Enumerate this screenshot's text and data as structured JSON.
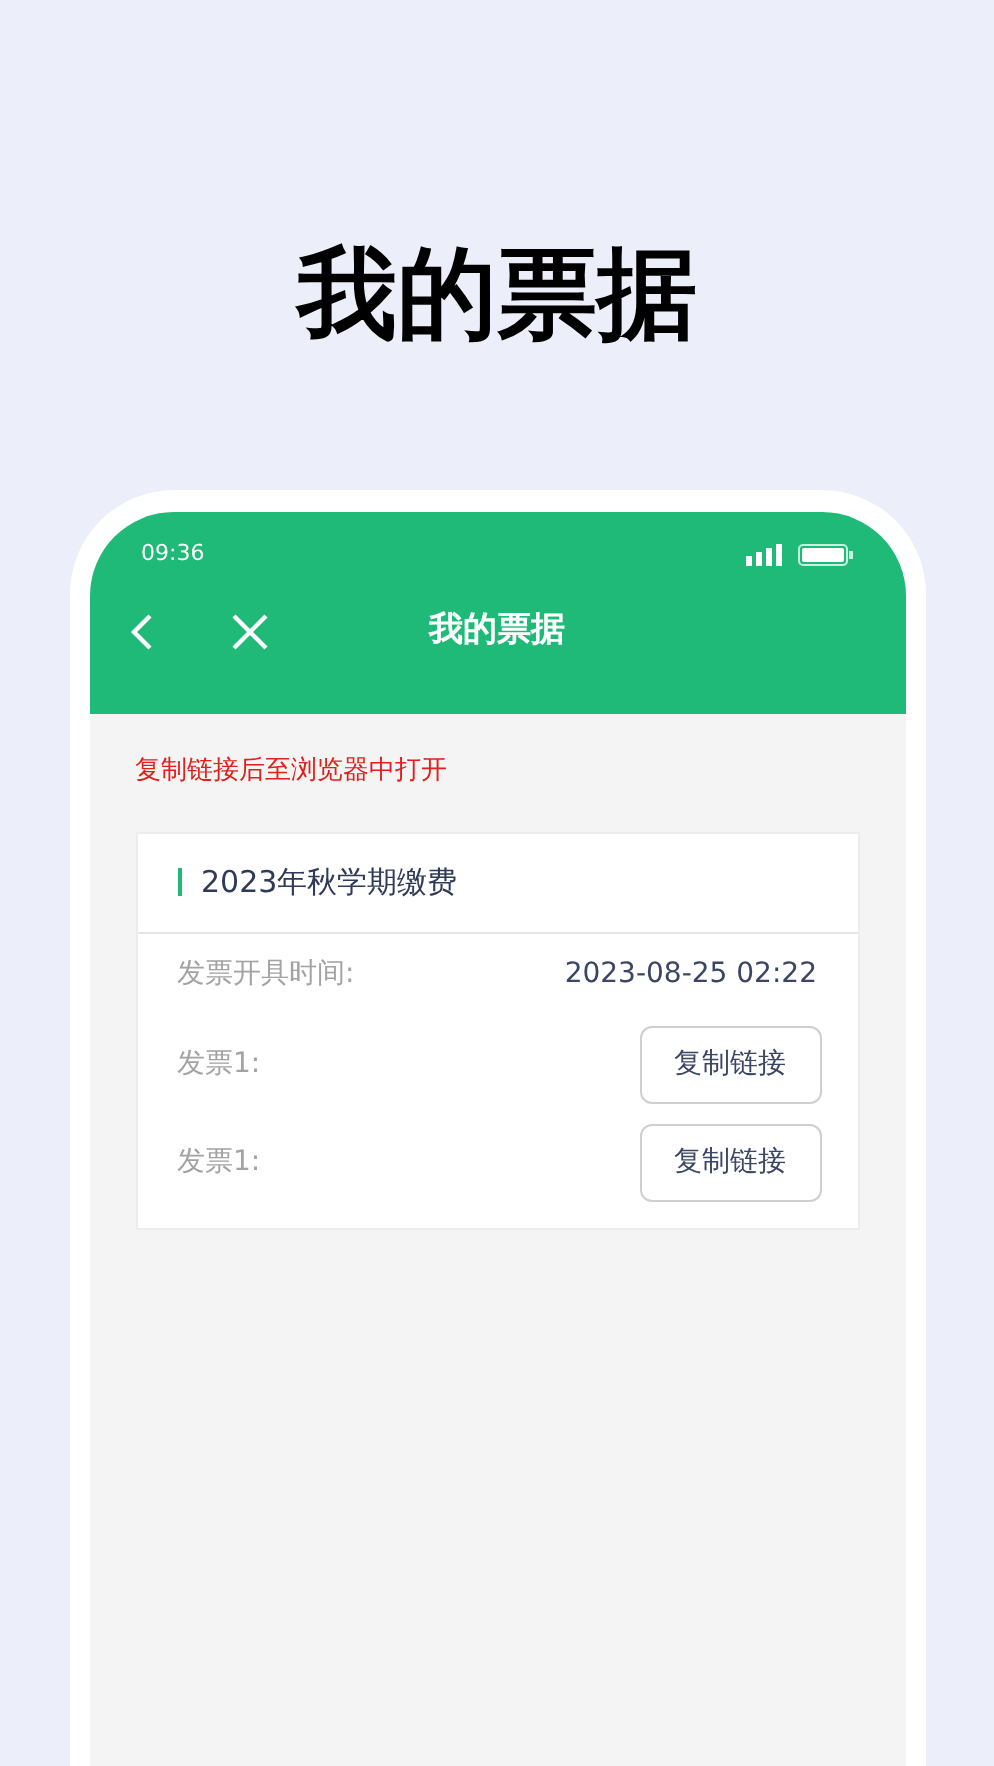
{
  "headline": "我的票据",
  "status_bar": {
    "time": "09:36"
  },
  "nav": {
    "title": "我的票据"
  },
  "notice": "复制链接后至浏览器中打开",
  "card": {
    "title": "2023年秋学期缴费",
    "rows": [
      {
        "kind": "text",
        "label": "发票开具时间:",
        "value": "2023-08-25 02:22"
      },
      {
        "kind": "button",
        "label": "发票1:",
        "button": "复制链接"
      },
      {
        "kind": "button",
        "label": "发票1:",
        "button": "复制链接"
      }
    ]
  }
}
